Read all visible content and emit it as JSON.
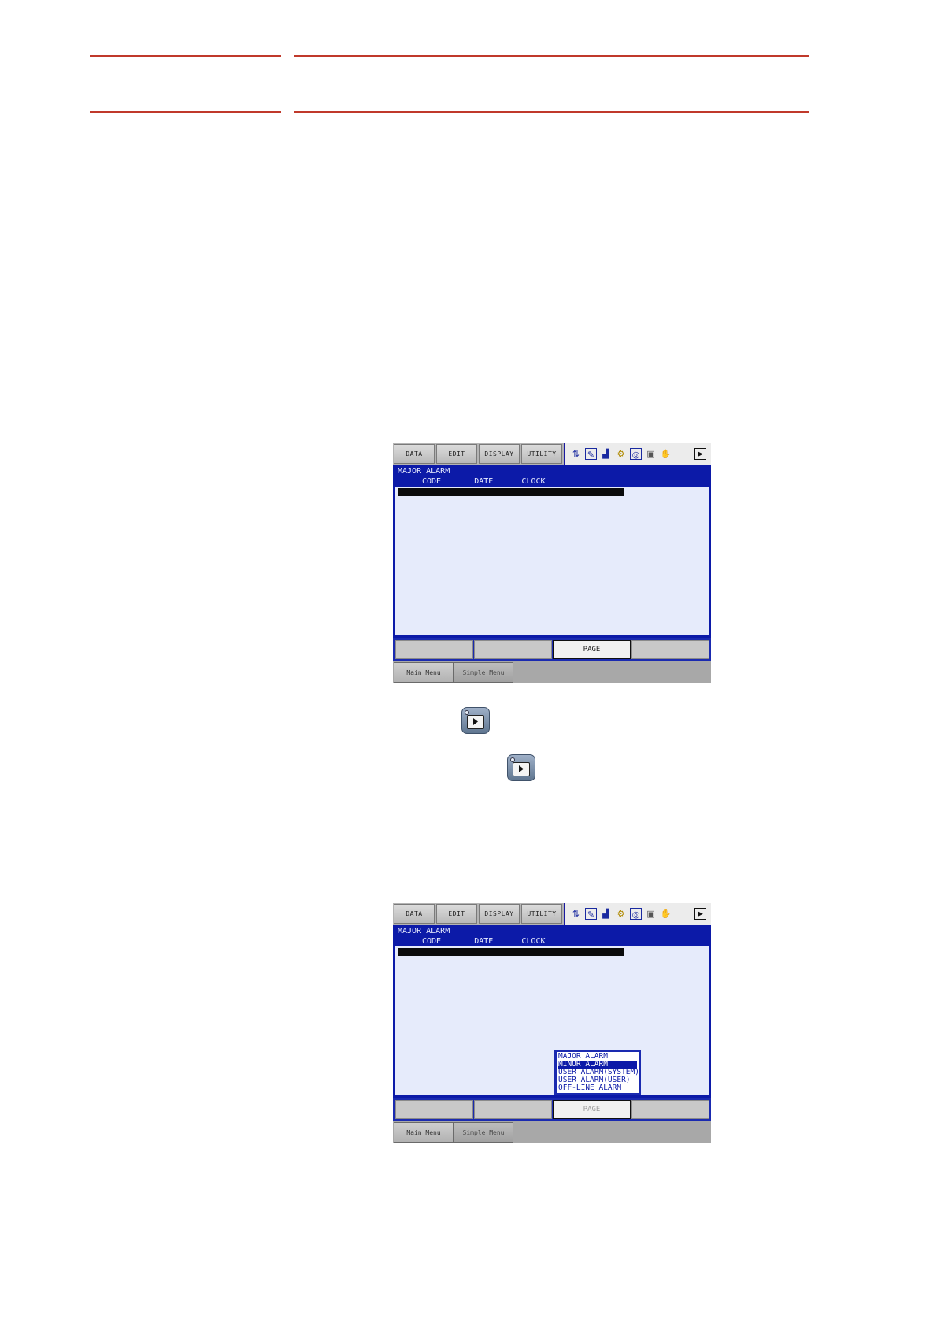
{
  "screen1": {
    "menu": [
      "DATA",
      "EDIT",
      "DISPLAY",
      "UTILITY"
    ],
    "title": "MAJOR ALARM",
    "columns": "CODE       DATE      CLOCK",
    "fkeys": [
      "",
      "",
      "PAGE",
      ""
    ],
    "bottom_menu": [
      "Main Menu",
      "Simple Menu"
    ]
  },
  "screen2": {
    "menu": [
      "DATA",
      "EDIT",
      "DISPLAY",
      "UTILITY"
    ],
    "title": "MAJOR ALARM",
    "columns": "CODE       DATE      CLOCK",
    "fkeys": [
      "",
      "",
      "PAGE",
      ""
    ],
    "bottom_menu": [
      "Main Menu",
      "Simple Menu"
    ],
    "popup": [
      "MAJOR ALARM",
      "MINOR ALARM",
      "USER ALARM(SYSTEM)",
      "USER ALARM(USER)",
      "OFF-LINE ALARM"
    ],
    "popup_selected": 1
  },
  "icons": {
    "status": [
      "arrows-icon",
      "edit-icon",
      "signal-icon",
      "tool-icon",
      "camera-icon",
      "pendant-icon",
      "hand-icon",
      "play-icon"
    ],
    "key": "page-key-icon"
  }
}
